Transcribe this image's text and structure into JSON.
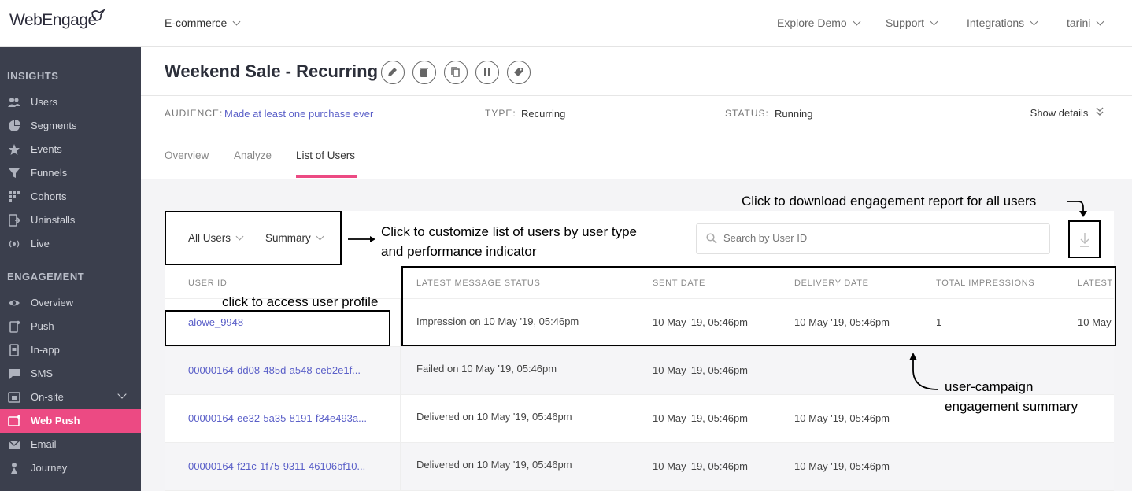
{
  "brand": {
    "logo_text": "WebEngage",
    "accent": "#ec4a83",
    "sidebar_bg": "#3b3f4d"
  },
  "topbar": {
    "project": "E-commerce",
    "nav": [
      "Explore Demo",
      "Support",
      "Integrations",
      "tarini"
    ]
  },
  "sidebar": {
    "insights_heading": "INSIGHTS",
    "insights": [
      {
        "label": "Users",
        "icon": "users-icon"
      },
      {
        "label": "Segments",
        "icon": "pie-icon"
      },
      {
        "label": "Events",
        "icon": "star-icon"
      },
      {
        "label": "Funnels",
        "icon": "funnel-icon"
      },
      {
        "label": "Cohorts",
        "icon": "grid-icon"
      },
      {
        "label": "Uninstalls",
        "icon": "uninstall-icon"
      },
      {
        "label": "Live",
        "icon": "broadcast-icon"
      }
    ],
    "engagement_heading": "ENGAGEMENT",
    "engagement": [
      {
        "label": "Overview",
        "icon": "eye-icon"
      },
      {
        "label": "Push",
        "icon": "mobile-icon"
      },
      {
        "label": "In-app",
        "icon": "inapp-icon"
      },
      {
        "label": "SMS",
        "icon": "sms-icon"
      },
      {
        "label": "On-site",
        "icon": "onsite-icon"
      },
      {
        "label": "Web Push",
        "icon": "webpush-icon"
      },
      {
        "label": "Email",
        "icon": "email-icon"
      },
      {
        "label": "Journey",
        "icon": "journey-icon"
      }
    ]
  },
  "campaign": {
    "title": "Weekend Sale - Recurring",
    "actions": [
      "edit-icon",
      "delete-icon",
      "copy-icon",
      "pause-icon",
      "tag-icon"
    ],
    "audience_key": "AUDIENCE:",
    "audience_val": "Made at least one purchase ever",
    "type_key": "TYPE:",
    "type_val": "Recurring",
    "status_key": "STATUS:",
    "status_val": "Running",
    "show_details": "Show details"
  },
  "tabs": [
    "Overview",
    "Analyze",
    "List of Users"
  ],
  "filters": {
    "user_type": "All Users",
    "indicator": "Summary"
  },
  "search": {
    "placeholder": "Search by User ID"
  },
  "table": {
    "headers": [
      "USER ID",
      "LATEST MESSAGE STATUS",
      "SENT DATE",
      "DELIVERY DATE",
      "TOTAL IMPRESSIONS",
      "LATEST"
    ],
    "rows": [
      {
        "user_id": "alowe_9948",
        "status": "Impression on 10 May '19, 05:46pm",
        "sent": "10 May '19, 05:46pm",
        "delivery": "10 May '19, 05:46pm",
        "impressions": "1",
        "latest": "10 May"
      },
      {
        "user_id": "00000164-dd08-485d-a548-ceb2e1f...",
        "status": "Failed on 10 May '19, 05:46pm",
        "sent": "10 May '19, 05:46pm",
        "delivery": "",
        "impressions": "",
        "latest": ""
      },
      {
        "user_id": "00000164-ee32-5a35-8191-f34e493a...",
        "status": "Delivered on 10 May '19, 05:46pm",
        "sent": "10 May '19, 05:46pm",
        "delivery": "10 May '19, 05:46pm",
        "impressions": "",
        "latest": ""
      },
      {
        "user_id": "00000164-f21c-1f75-9311-46106bf10...",
        "status": "Delivered on 10 May '19, 05:46pm",
        "sent": "10 May '19, 05:46pm",
        "delivery": "10 May '19, 05:46pm",
        "impressions": "",
        "latest": ""
      }
    ]
  },
  "annotations": {
    "download": "Click to download engagement report for all users",
    "customize_1": "Click to customize list of users by user type",
    "customize_2": "and performance indicator",
    "profile": "click to access user profile",
    "summary_1": "user-campaign",
    "summary_2": "engagement summary"
  }
}
